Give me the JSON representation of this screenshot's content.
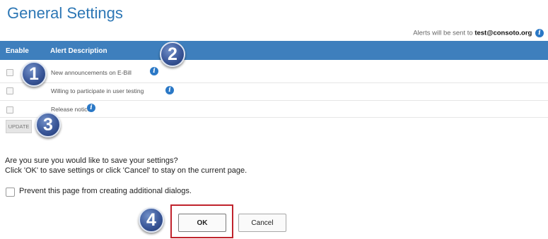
{
  "page": {
    "title": "General Settings",
    "alerts_prefix": "Alerts will be sent to ",
    "alerts_email": "test@consoto.org"
  },
  "table": {
    "headers": {
      "enable": "Enable",
      "description": "Alert Description"
    },
    "rows": [
      {
        "description": "New announcements on E-Bill",
        "checked": false
      },
      {
        "description": "Willing to participate in user testing",
        "checked": false
      },
      {
        "description": "Release notice",
        "checked": false
      }
    ],
    "update_label": "UPDATE"
  },
  "badges": [
    "1",
    "2",
    "3",
    "4"
  ],
  "dialog": {
    "question": "Are you sure you would like to save your settings?",
    "instruction": "Click 'OK' to save settings or click 'Cancel' to stay on the current page.",
    "prevent_label": "Prevent this page from creating additional dialogs.",
    "ok_label": "OK",
    "cancel_label": "Cancel"
  },
  "icons": {
    "info": "info-icon"
  },
  "colors": {
    "title": "#2d77b5",
    "header_bg": "#3e7fbd",
    "badge": "#3a5799",
    "highlight": "#c0232c"
  }
}
